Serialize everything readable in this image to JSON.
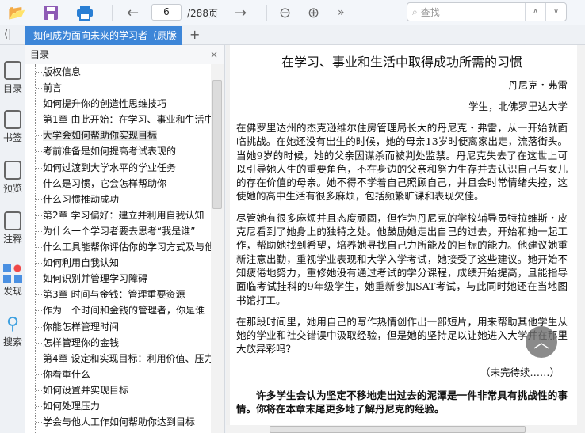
{
  "toolbar": {
    "page_current": "6",
    "page_total": "/288页",
    "search_placeholder": "查找",
    "more": "»"
  },
  "tab": {
    "title": "如何成为面向未来的学习者（原版",
    "close": "×",
    "add": "+",
    "collapse": "⟨|"
  },
  "rail": [
    {
      "label": "目录"
    },
    {
      "label": "书签"
    },
    {
      "label": "预览"
    },
    {
      "label": "注释"
    },
    {
      "label": "发现"
    },
    {
      "label": "搜索"
    }
  ],
  "toc": {
    "title": "目录",
    "close": "×",
    "active_index": 4,
    "items": [
      "版权信息",
      "前言",
      "如何提升你的创造性思维技巧",
      "第1章 由此开始：在学习、事业和生活中",
      "大学会如何帮助你实现目标",
      "考前准备是如何提高考试表现的",
      "如何过渡到大学水平的学业任务",
      "什么是习惯，它会怎样帮助你",
      "什么习惯推动成功",
      "第2章 学习偏好：建立并利用自我认知",
      "为什么一个学习者要去思考“我是谁”",
      "什么工具能帮你评估你的学习方式及与他",
      "如何利用自我认知",
      "如何识别并管理学习障碍",
      "第3章 时间与金钱：管理重要资源",
      "作为一个时间和金钱的管理者，你是谁",
      "你能怎样管理时间",
      "怎样管理你的金钱",
      "第4章 设定和实现目标：利用价值、压力",
      "你看重什么",
      "如何设置并实现目标",
      "如何处理压力",
      "学会与他人工作如何帮助你达到目标"
    ]
  },
  "document": {
    "title": "在学习、事业和生活中取得成功所需的习惯",
    "author": "丹尼克・弗雷",
    "affiliation": "学生，北佛罗里达大学",
    "paragraphs": [
      "在佛罗里达州的杰克逊维尔住房管理局长大的丹尼克・弗雷，从一开始就面临挑战。在她还没有出生的时候，她的母亲13岁时便离家出走，流落街头。当她9岁的时候，她的父亲因谋杀而被判处监禁。丹尼克失去了在这世上可以引导她人生的重要角色，不在身边的父亲和努力生存并去认识自己与女儿的存在价值的母亲。她不得不学着自己照顾自己，并且会时常情绪失控，这使她的高中生活有很多麻烦，包括频繁旷课和表现欠佳。",
      "尽管她有很多麻烦并且态度顽固，但作为丹尼克的学校辅导员特拉维斯・皮克尼看到了她身上的独特之处。他鼓励她走出自己的过去，开始和她一起工作，帮助她找到希望，培养她寻找自己力所能及的目标的能力。他建议她重新注意出勤，重视学业表现和大学入学考试，她接受了这些建议。她开始不知疲倦地努力，重修她没有通过考试的学分课程，成绩开始提高，且能指导面临考试挂科的9年级学生，她重新参加SAT考试，与此同时她还在当地图书馆打工。",
      "在那段时间里，她用自己的写作热情创作出一部短片，用来帮助其他学生从她的学业和社交错误中汲取经验，但是她的坚持足以让她进入大学并在那里大放异彩吗？"
    ],
    "continued": "（未完待续……）",
    "closing": "许多学生会认为坚定不移地走出过去的泥潭是一件非常具有挑战性的事情。你将在本章末尾更多地了解丹尼克的经验。"
  },
  "colors": {
    "accent": "#3d86d8",
    "folder": "#e8a931",
    "save": "#8e5bb5",
    "print": "#2a7fd4"
  }
}
